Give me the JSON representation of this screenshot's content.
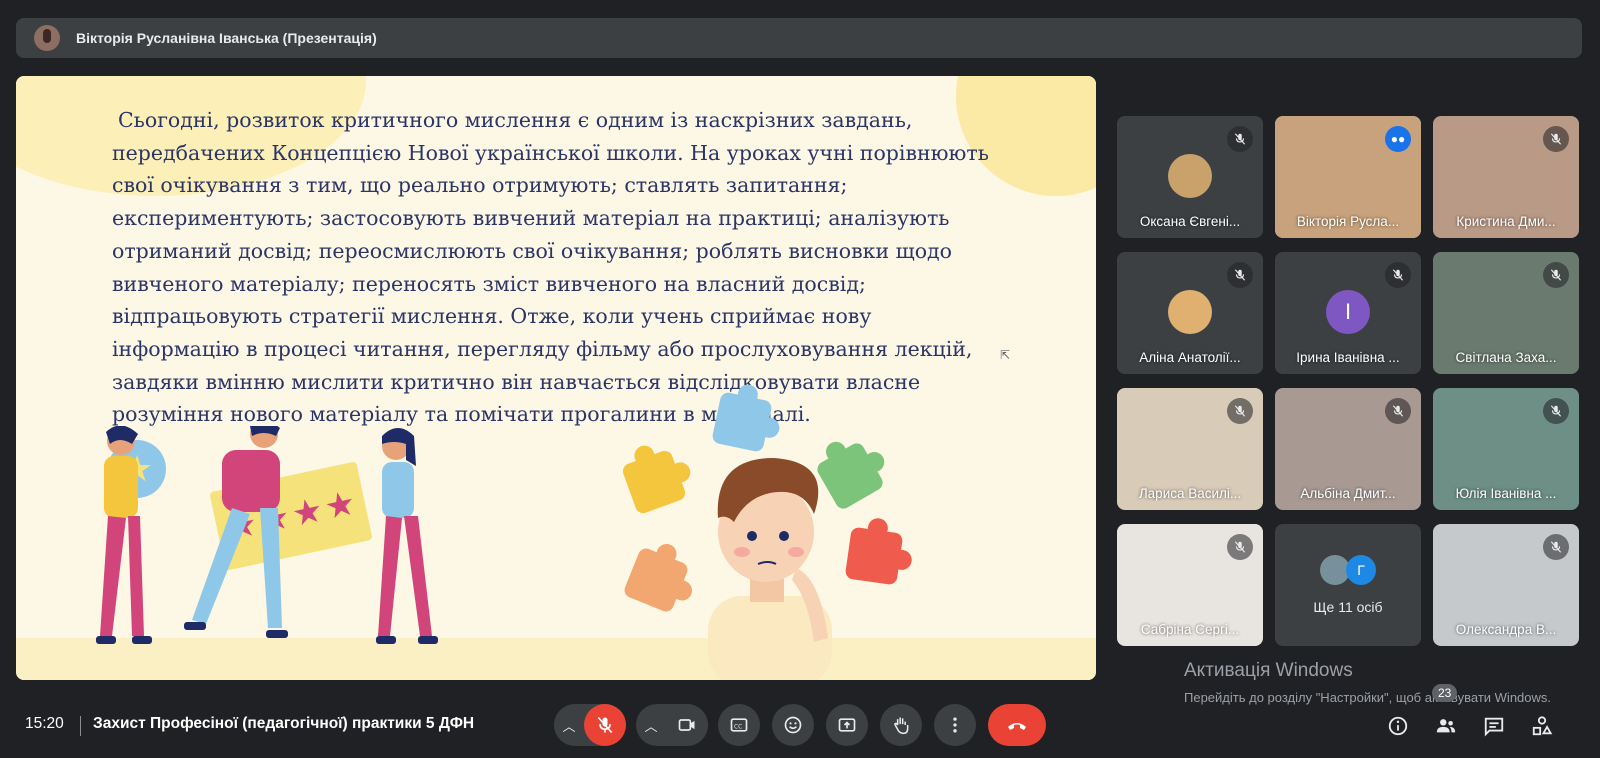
{
  "presenter_bar": {
    "title": "Вікторія Русланівна Іванська (Презентація)"
  },
  "slide": {
    "text": "Сьогодні, розвиток критичного мислення є одним із наскрізних завдань, передбачених Концепцією Нової української школи. На уроках учні порівнюють свої очікування з тим, що реально отримують; ставлять запитання; експериментують; застосовують вивчений матеріал на практиці; аналізують отриманий досвід; переосмислюють свої очікування; роблять висновки щодо вивченого матеріалу; переносять зміст вивченого на власний досвід; відпрацьовують стратегії мислення. Отже, коли учень сприймає нову інформацію в процесі читання, перегляду фільму або прослуховування лекцій, завдяки вмінню мислити критично він навчається відслідковувати власне розуміння нового матеріалу та помічати прогалини в матеріалі."
  },
  "participants": [
    {
      "name": "Оксана Євгені...",
      "muted": true,
      "bg": "#3c4043",
      "avatar": true,
      "avatar_color": "#c9a16a"
    },
    {
      "name": "Вікторія Русла...",
      "muted": false,
      "speaking": true,
      "bg": "#c8a27c"
    },
    {
      "name": "Кристина Дми...",
      "muted": true,
      "bg": "#b99a86"
    },
    {
      "name": "Аліна Анатолії...",
      "muted": true,
      "bg": "#3c4043",
      "avatar": true,
      "avatar_color": "#e0b070"
    },
    {
      "name": "Ірина Іванівна ...",
      "muted": true,
      "bg": "#3c4043",
      "letter": "І"
    },
    {
      "name": "Світлана Заха...",
      "muted": true,
      "bg": "#6a7a6f"
    },
    {
      "name": "Лариса Василі...",
      "muted": true,
      "bg": "#d8cbb8"
    },
    {
      "name": "Альбіна Дмит...",
      "muted": true,
      "bg": "#a89a93"
    },
    {
      "name": "Юлія Іванівна ...",
      "muted": true,
      "bg": "#6d8f86"
    },
    {
      "name": "Сабріна Сергі...",
      "muted": true,
      "bg": "#e8e4e0"
    },
    {
      "name": "Ще 11 осіб",
      "more": true,
      "initial": "Г"
    },
    {
      "name": "Олександра В...",
      "muted": true,
      "bg": "#c5c9cc"
    }
  ],
  "activation": {
    "title": "Активація Windows",
    "body": "Перейдіть до розділу \"Настройки\", щоб активувати Windows."
  },
  "bottom_bar": {
    "time": "15:20",
    "meeting_title": "Захист Професіної (педагогічної) практики 5 ДФН",
    "participants_count": "23"
  },
  "icons": {
    "mic_off": "mic-off-icon",
    "camera": "camera-icon",
    "captions": "captions-icon",
    "emoji": "emoji-icon",
    "present": "present-icon",
    "hand": "raise-hand-icon",
    "more": "more-vert-icon",
    "end_call": "end-call-icon",
    "info": "info-icon",
    "people": "people-icon",
    "chat": "chat-icon",
    "activities": "activities-icon"
  },
  "colors": {
    "background": "#202124",
    "surface": "#3c4043",
    "danger": "#ea4335",
    "accent": "#8ab4f8"
  }
}
